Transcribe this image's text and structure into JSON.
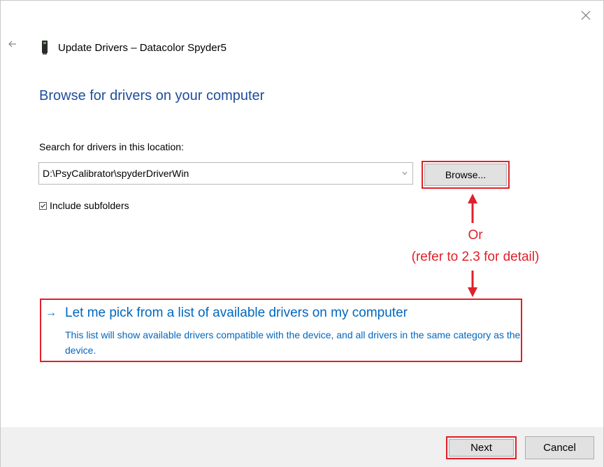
{
  "window": {
    "title": "Update Drivers – Datacolor Spyder5",
    "close_icon": "close-icon",
    "back_icon": "back-arrow-icon",
    "device_icon": "device-icon"
  },
  "page": {
    "title": "Browse for drivers on your computer"
  },
  "search": {
    "label": "Search for drivers in this location:",
    "path_value": "D:\\PsyCalibrator\\spyderDriverWin",
    "browse_label": "Browse...",
    "include_subfolders_label": "Include subfolders",
    "include_subfolders_checked": true
  },
  "annotation": {
    "or_text": "Or",
    "refer_text": "(refer to 2.3 for detail)",
    "color": "#e0202a"
  },
  "pick_option": {
    "arrow": "→",
    "title": "Let me pick from a list of available drivers on my computer",
    "description": "This list will show available drivers compatible with the device, and all drivers in the same category as the device."
  },
  "footer": {
    "next_label": "Next",
    "cancel_label": "Cancel"
  },
  "colors": {
    "heading": "#1f4e9b",
    "link": "#0067c0",
    "highlight": "#e0202a",
    "footer_bg": "#f0f0f0"
  }
}
